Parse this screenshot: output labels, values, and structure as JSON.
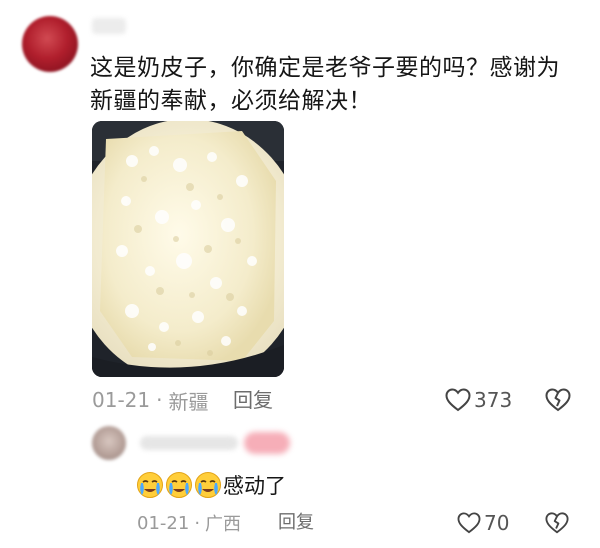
{
  "main_comment": {
    "text": "这是奶皮子，你确定是老爷子要的吗？感谢为新疆的奉献，必须给解决！",
    "date": "01-21",
    "separator": "·",
    "location": "新疆",
    "reply_label": "回复",
    "like_count": "373",
    "photo_icon": "milk-skin-photo"
  },
  "sub_reply": {
    "text": "感动了",
    "emojis": [
      "crying-face-emoji",
      "crying-face-emoji",
      "crying-face-emoji"
    ],
    "date": "01-21",
    "separator": "·",
    "location": "广西",
    "reply_label": "回复",
    "like_count": "70"
  },
  "icons": {
    "like": "heart-outline-icon",
    "dislike": "broken-heart-icon"
  },
  "colors": {
    "meta_text": "#9a9a9a",
    "body_text": "#161616",
    "avatar_main": "#b01e2c",
    "badge_pink": "#f6aeb8"
  }
}
